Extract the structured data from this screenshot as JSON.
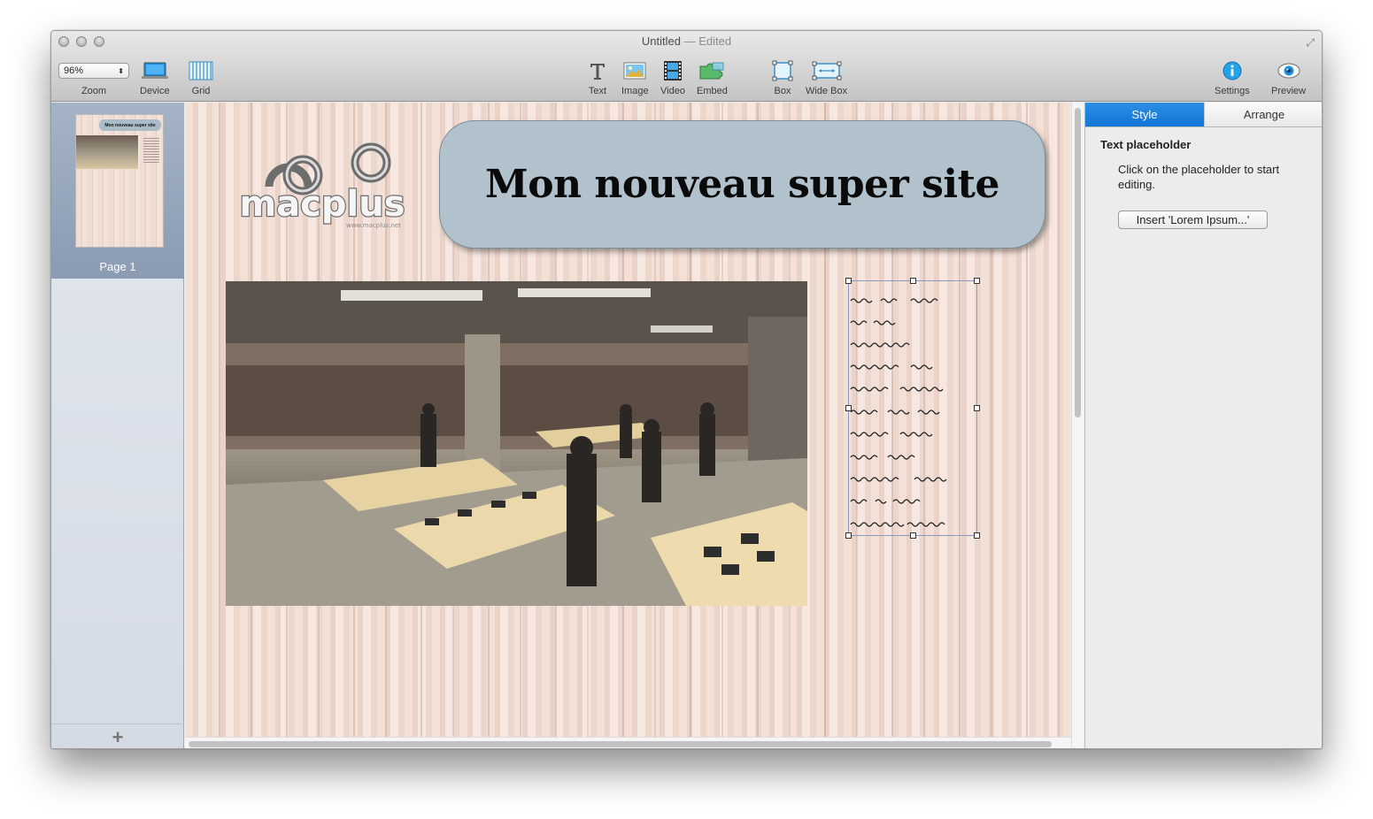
{
  "window": {
    "title": "Untitled",
    "title_suffix": "— Edited"
  },
  "toolbar": {
    "zoom_value": "96%",
    "zoom_label": "Zoom",
    "device_label": "Device",
    "grid_label": "Grid",
    "text_label": "Text",
    "image_label": "Image",
    "video_label": "Video",
    "embed_label": "Embed",
    "box_label": "Box",
    "widebox_label": "Wide Box",
    "settings_label": "Settings",
    "preview_label": "Preview"
  },
  "sidebar": {
    "pages": [
      {
        "label": "Page 1",
        "thumb_title": "Mon nouveau super site"
      }
    ]
  },
  "canvas": {
    "banner_title": "Mon nouveau super site",
    "logo_text": "macplus",
    "logo_url": "www.macplus.net"
  },
  "inspector": {
    "tabs": [
      "Style",
      "Arrange"
    ],
    "active_tab": "Style",
    "heading": "Text placeholder",
    "description": "Click on the placeholder to start editing.",
    "button_label": "Insert 'Lorem Ipsum...'"
  },
  "colors": {
    "accent": "#1a7ede",
    "banner_fill": "#b1c2cc",
    "wood_light": "#f3e0d6"
  }
}
